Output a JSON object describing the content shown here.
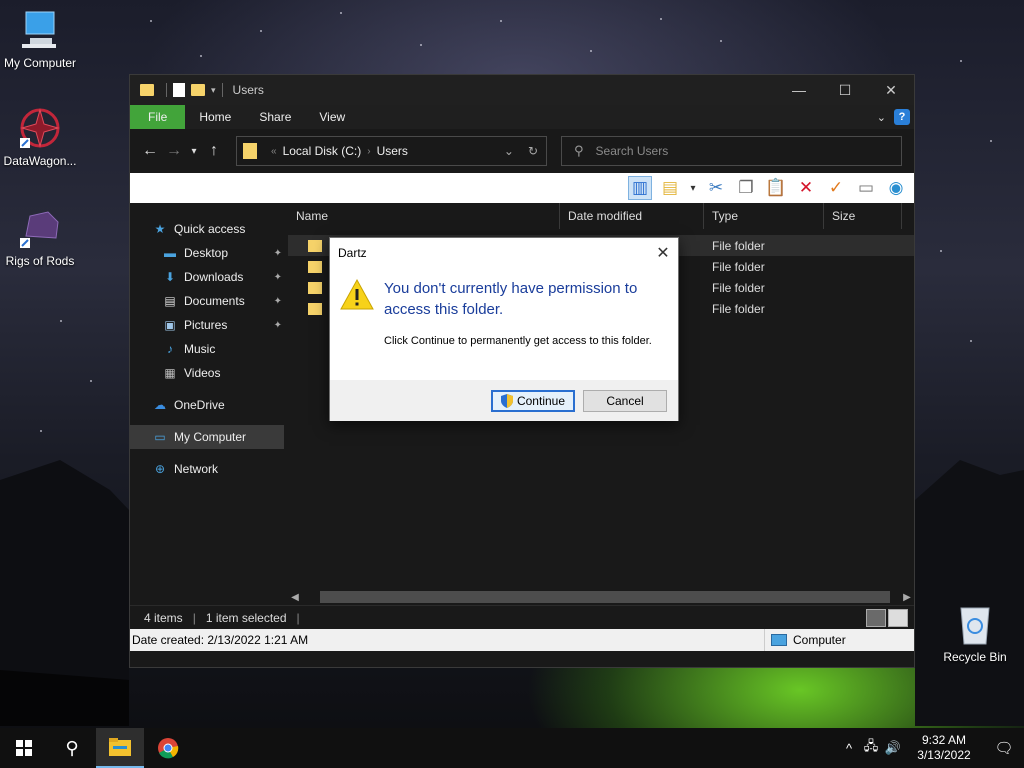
{
  "desktop": {
    "icons": [
      {
        "label": "My Computer"
      },
      {
        "label": "DataWagon..."
      },
      {
        "label": "Rigs of Rods"
      },
      {
        "label": "Recycle Bin"
      }
    ]
  },
  "window": {
    "title": "Users",
    "ribbon_tabs": [
      "File",
      "Home",
      "Share",
      "View"
    ],
    "address": {
      "root": "Local Disk (C:)",
      "current": "Users"
    },
    "search_placeholder": "Search Users",
    "nav": [
      {
        "label": "Quick access"
      },
      {
        "label": "Desktop"
      },
      {
        "label": "Downloads"
      },
      {
        "label": "Documents"
      },
      {
        "label": "Pictures"
      },
      {
        "label": "Music"
      },
      {
        "label": "Videos"
      },
      {
        "label": "OneDrive"
      },
      {
        "label": "My Computer"
      },
      {
        "label": "Network"
      }
    ],
    "columns": {
      "name": "Name",
      "date": "Date modified",
      "type": "Type",
      "size": "Size"
    },
    "rows": [
      {
        "type": "File folder"
      },
      {
        "type": "File folder"
      },
      {
        "type": "File folder"
      },
      {
        "type": "File folder"
      }
    ],
    "status": {
      "items": "4 items",
      "selected": "1 item selected"
    },
    "info": {
      "created": "Date created: 2/13/2022 1:21 AM",
      "location": "Computer"
    }
  },
  "dialog": {
    "title": "Dartz",
    "main": "You don't currently have permission to access this folder.",
    "sub": "Click Continue to permanently get access to this folder.",
    "continue_label": "Continue",
    "cancel_label": "Cancel"
  },
  "taskbar": {
    "time": "9:32 AM",
    "date": "3/13/2022"
  }
}
